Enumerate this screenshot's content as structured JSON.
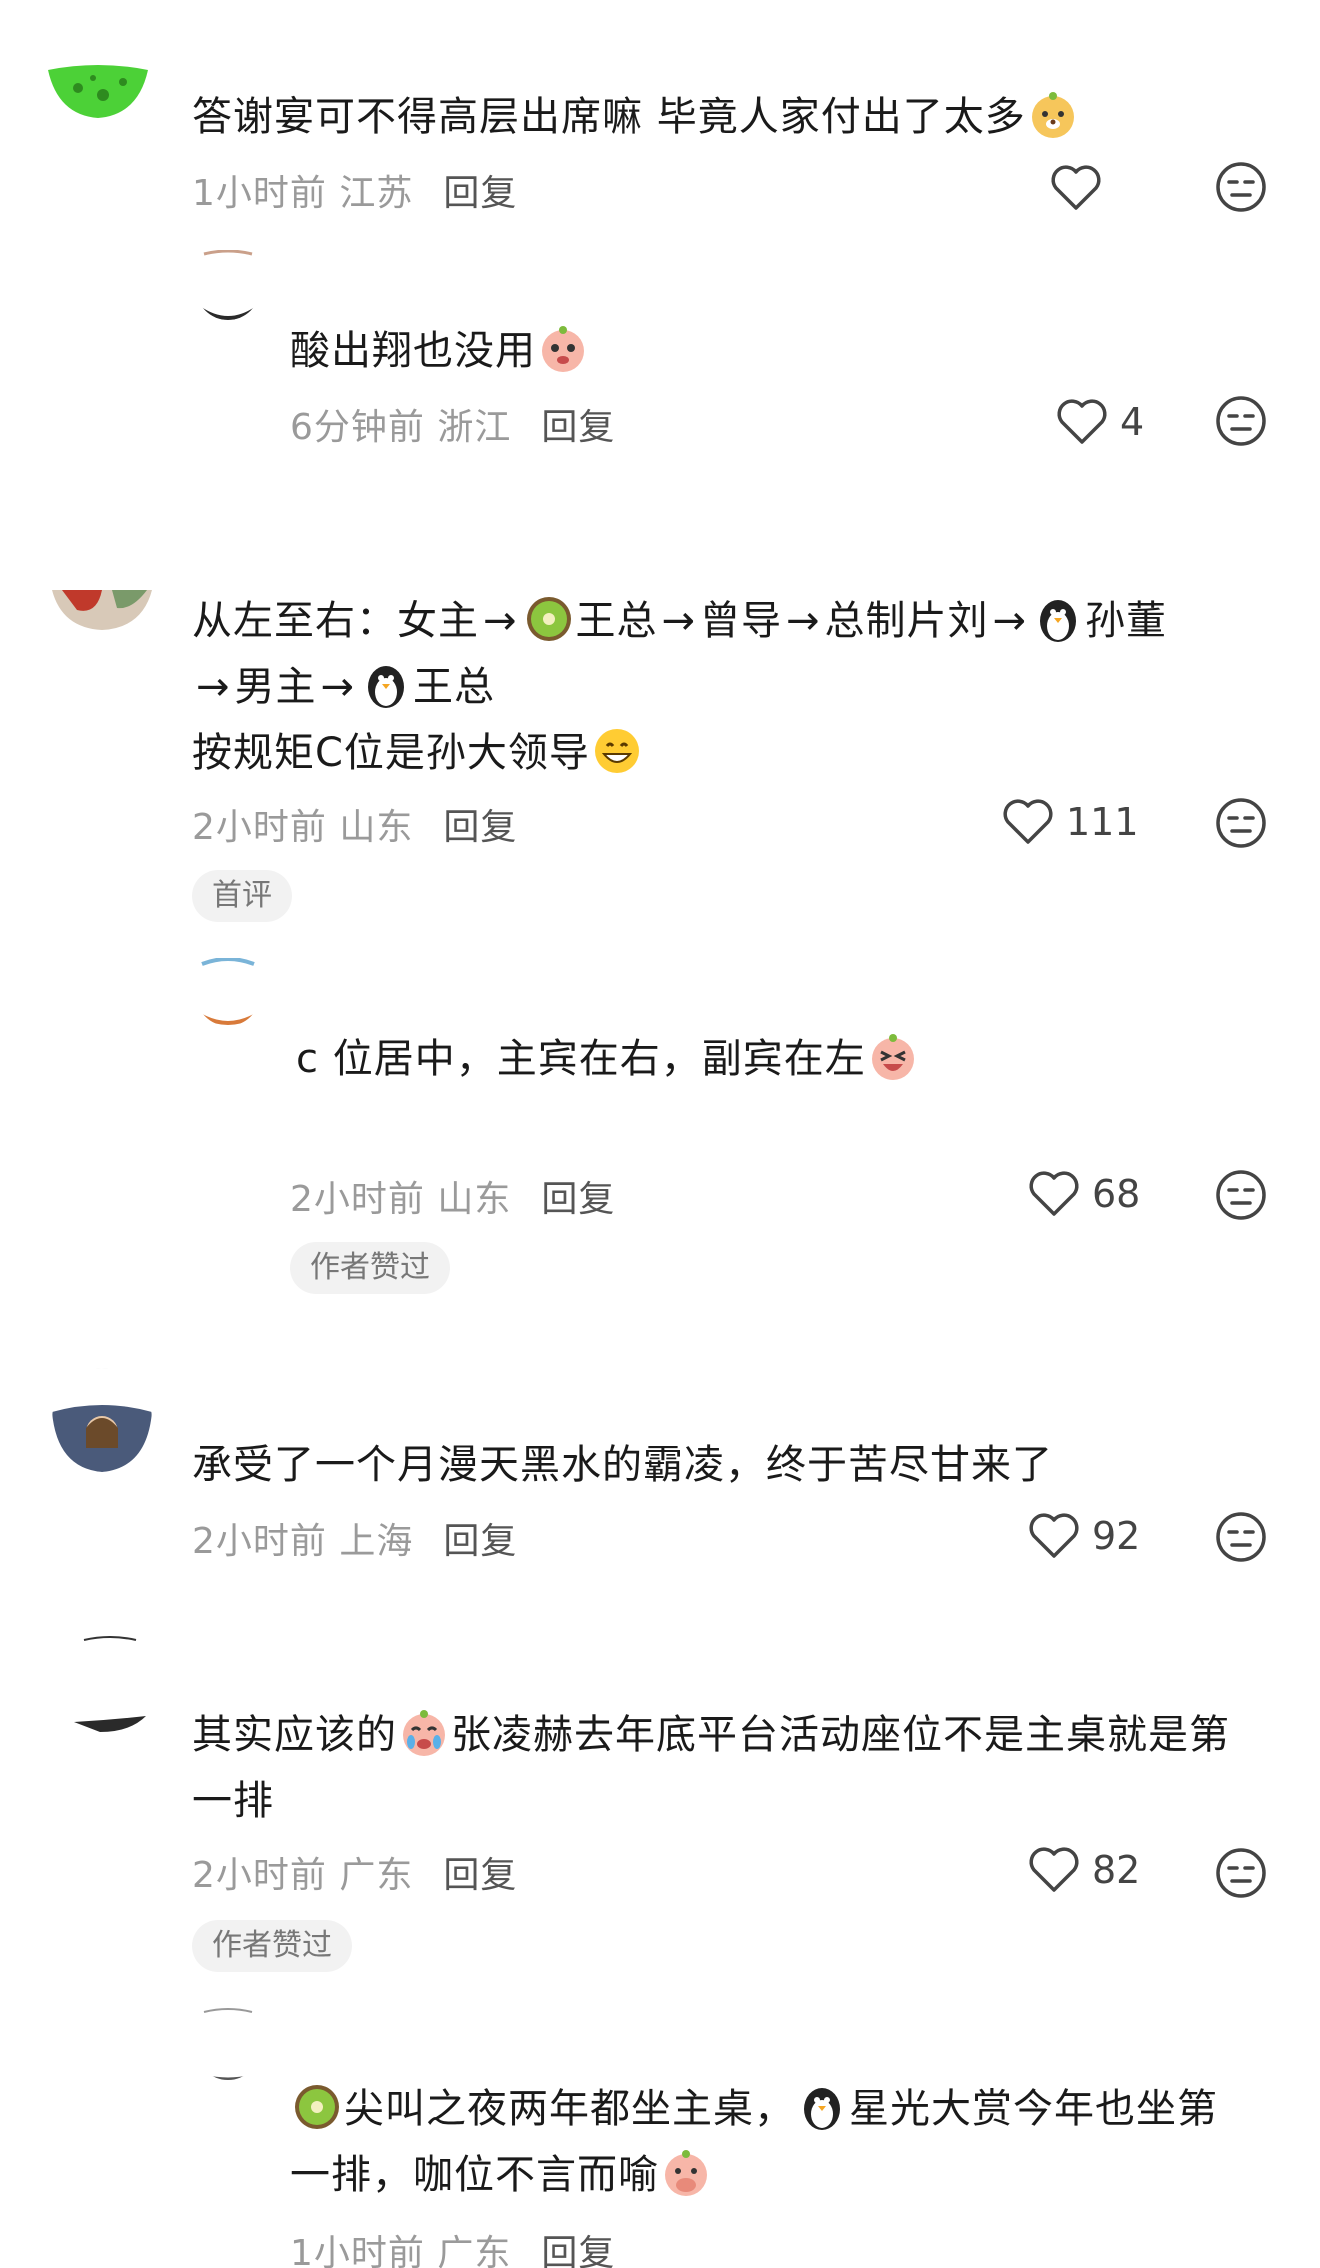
{
  "comments": [
    {
      "text": "答谢宴可不得高层出席嘛  毕竟人家付出了太多",
      "time": "1小时前",
      "location": "江苏",
      "reply_label": "回复",
      "likes": ""
    },
    {
      "text": "酸出翔也没用",
      "time": "6分钟前",
      "location": "浙江",
      "reply_label": "回复",
      "likes": "4"
    },
    {
      "line1_a": "从左至右：女主",
      "line1_b": "王总",
      "line1_c": "曾导",
      "line1_d": "总制片刘",
      "line1_e": "孙董",
      "line2_a": "男主",
      "line2_b": "王总",
      "line3": "按规矩C位是孙大领导",
      "time": "2小时前",
      "location": "山东",
      "reply_label": "回复",
      "likes": "111",
      "tag": "首评"
    },
    {
      "text": "c 位居中，主宾在右，副宾在左",
      "time": "2小时前",
      "location": "山东",
      "reply_label": "回复",
      "likes": "68",
      "tag": "作者赞过"
    },
    {
      "text": "承受了一个月漫天黑水的霸凌，终于苦尽甘来了",
      "time": "2小时前",
      "location": "上海",
      "reply_label": "回复",
      "likes": "92"
    },
    {
      "line1_a": "其实应该的",
      "line1_b": "张凌赫去年底平台活动座位不是主桌就是第",
      "line2": "一排",
      "time": "2小时前",
      "location": "广东",
      "reply_label": "回复",
      "likes": "82",
      "tag": "作者赞过"
    },
    {
      "line1_a": "尖叫之夜两年都坐主桌，",
      "line1_b": "星光大赏今年也坐第",
      "line2": "一排，咖位不言而喻",
      "time": "1小时前",
      "location": "广东",
      "reply_label": "回复"
    }
  ],
  "arrow": "→",
  "colors": {
    "text": "#1a1a1a",
    "meta": "#9a9a9a",
    "tag_bg": "#f2f2f2"
  },
  "icons": [
    "heart-outline-icon",
    "neutral-face-icon",
    "kiwi-emoji",
    "penguin-emoji",
    "grin-emoji",
    "blush-emoji",
    "cry-emoji"
  ]
}
